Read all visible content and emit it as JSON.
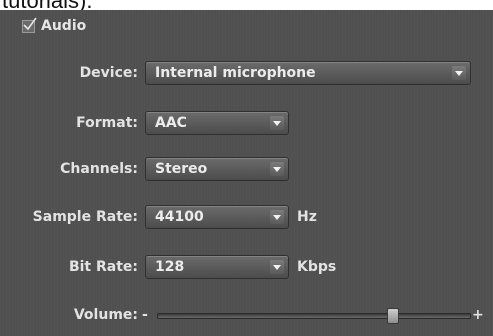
{
  "caption_fragment": "tutorials).",
  "audio": {
    "label": "Audio",
    "checked": true
  },
  "fields": {
    "device": {
      "label": "Device:",
      "value": "Internal microphone"
    },
    "format": {
      "label": "Format:",
      "value": "AAC"
    },
    "channels": {
      "label": "Channels:",
      "value": "Stereo"
    },
    "sample_rate": {
      "label": "Sample Rate:",
      "value": "44100",
      "unit": "Hz"
    },
    "bit_rate": {
      "label": "Bit Rate:",
      "value": "128",
      "unit": "Kbps"
    }
  },
  "volume": {
    "label": "Volume:",
    "minus": "-",
    "plus": "+",
    "level": 0.75
  },
  "icons": {
    "checkbox": "checkmark-icon",
    "dropdown": "chevron-down-icon"
  }
}
